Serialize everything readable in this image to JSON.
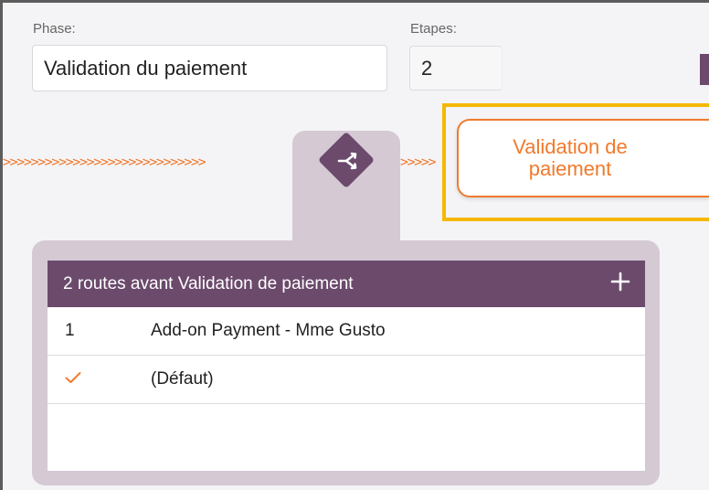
{
  "phase": {
    "label": "Phase:",
    "value": "Validation du paiement"
  },
  "etapes": {
    "label": "Etapes:",
    "value": "2"
  },
  "connector_left": ">>>>>>>>>>>>>>>>>>>>>>>>>>>>>",
  "connector_right": ">>>>>",
  "step_node": {
    "line1": "Validation de",
    "line2": "paiement"
  },
  "branch_icon": "branch-split-icon",
  "routes_panel": {
    "title": "2 routes avant Validation de paiement",
    "add_icon": "plus-icon",
    "rows": [
      {
        "index": "1",
        "name": "Add-on Payment - Mme Gusto"
      },
      {
        "index_icon": "checkmark-icon",
        "name": "(Défaut)"
      }
    ]
  },
  "colors": {
    "accent_orange": "#f07a2d",
    "brand_purple": "#6b4a6c",
    "panel_lilac": "#d5c9d4",
    "highlight_yellow": "#f5b800"
  }
}
